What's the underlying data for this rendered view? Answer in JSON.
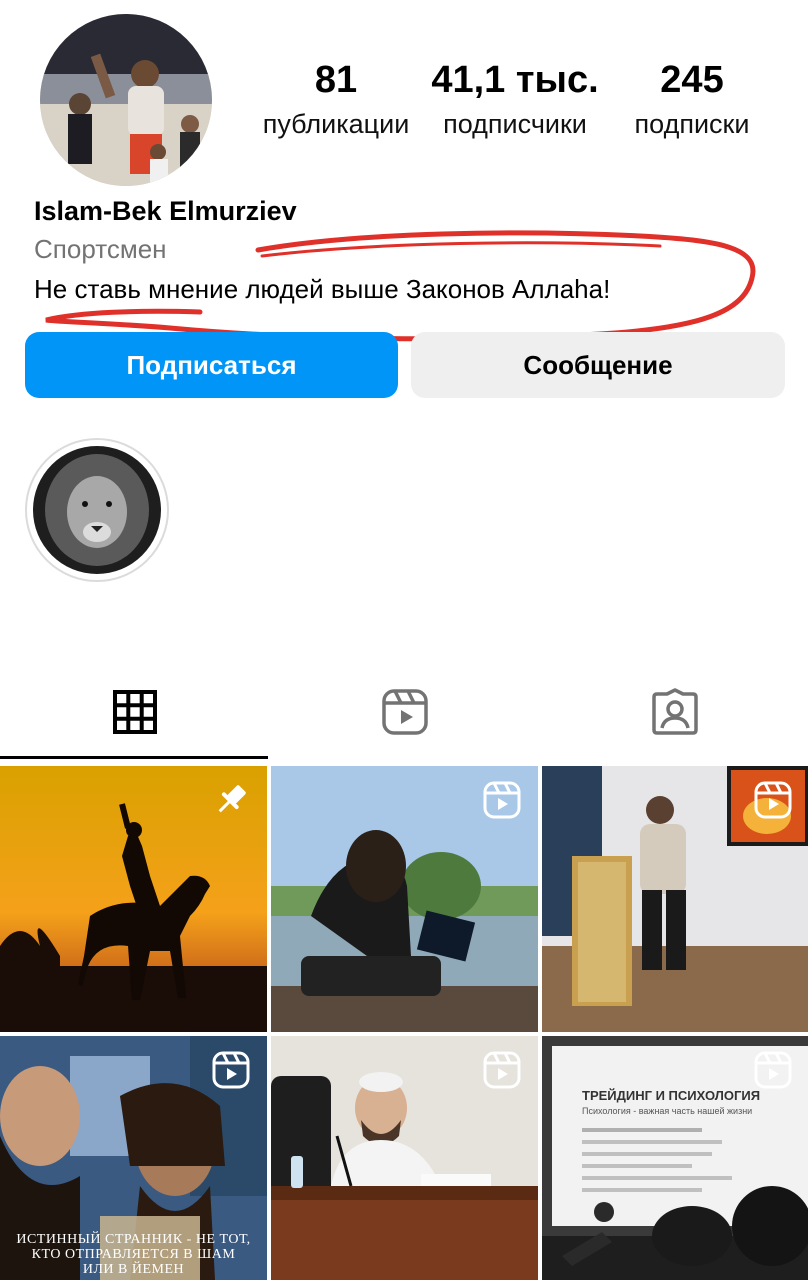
{
  "profile": {
    "name": "Islam-Bek Elmurziev",
    "category": "Спортсмен",
    "bio": "Не ставь мнение людей выше Законов Аллаhа!"
  },
  "stats": [
    {
      "value": "81",
      "label": "публикации"
    },
    {
      "value": "41,1 тыс.",
      "label": "подписчики"
    },
    {
      "value": "245",
      "label": "подписки"
    }
  ],
  "actions": {
    "follow_label": "Подписаться",
    "message_label": "Сообщение"
  },
  "colors": {
    "follow_button": "#0095f6",
    "message_button": "#efefef",
    "annotation_stroke": "#e0302a",
    "secondary_text": "#737373"
  },
  "tabs": [
    {
      "icon": "grid-icon",
      "selected": true
    },
    {
      "icon": "reels-icon",
      "selected": false
    },
    {
      "icon": "tagged-icon",
      "selected": false
    }
  ],
  "posts": [
    {
      "scene": "horse-rider-sunset",
      "badge": "pin-icon"
    },
    {
      "scene": "man-reading-book",
      "badge": "reels-icon"
    },
    {
      "scene": "room-with-fireplace-tv",
      "badge": "reels-icon"
    },
    {
      "scene": "two-bearded-men",
      "badge": "reels-icon",
      "caption_lines": [
        "ИСТИННЫЙ СТРАННИК - НЕ ТОТ,",
        "КТО ОТПРАВЛЯЕТСЯ В ШАМ",
        "ИЛИ В ЙЕМЕН"
      ]
    },
    {
      "scene": "man-at-lecture-desk",
      "badge": "reels-icon"
    },
    {
      "scene": "presentation-slide",
      "badge": "reels-icon",
      "slide_title": "ТРЕЙДИНГ И ПСИХОЛОГИЯ",
      "slide_subtitle": "Психология - важная часть нашей жизни"
    }
  ]
}
